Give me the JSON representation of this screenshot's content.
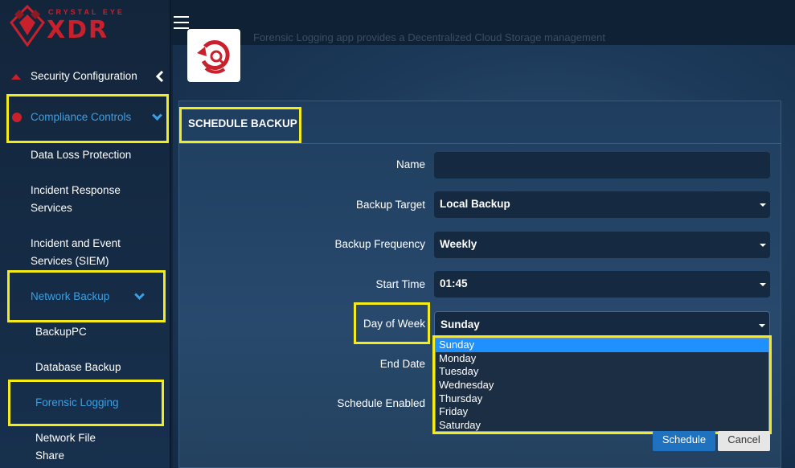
{
  "brand": {
    "small": "CRYSTAL EYE",
    "big": "XDR"
  },
  "header": {
    "intro_text": "Forensic Logging app provides a Decentralized Cloud Storage management"
  },
  "sidebar": {
    "items": [
      {
        "label": "Security Configuration"
      },
      {
        "label": "Compliance Controls"
      },
      {
        "label": "Data Loss Protection"
      },
      {
        "label": "Incident Response"
      },
      {
        "label": "Services"
      },
      {
        "label": "Incident and Event"
      },
      {
        "label": "Services (SIEM)"
      },
      {
        "label": "Network Backup"
      },
      {
        "label": "BackupPC"
      },
      {
        "label": "Database Backup"
      },
      {
        "label": "Forensic Logging"
      },
      {
        "label": "Network File"
      },
      {
        "label": "Share"
      }
    ]
  },
  "panel": {
    "title": "SCHEDULE BACKUP"
  },
  "form": {
    "name_label": "Name",
    "name_value": "",
    "target_label": "Backup Target",
    "target_value": "Local Backup",
    "frequency_label": "Backup Frequency",
    "frequency_value": "Weekly",
    "start_label": "Start Time",
    "start_value": "01:45",
    "day_label": "Day of Week",
    "day_value": "Sunday",
    "end_label": "End Date",
    "enabled_label": "Schedule Enabled"
  },
  "day_options": [
    "Sunday",
    "Monday",
    "Tuesday",
    "Wednesday",
    "Thursday",
    "Friday",
    "Saturday"
  ],
  "buttons": {
    "schedule": "Schedule",
    "cancel": "Cancel"
  },
  "colors": {
    "accent": "#3aa0e6",
    "brand": "#c8202c",
    "highlight": "#f4ec1a",
    "selected_option": "#1e90ff"
  }
}
